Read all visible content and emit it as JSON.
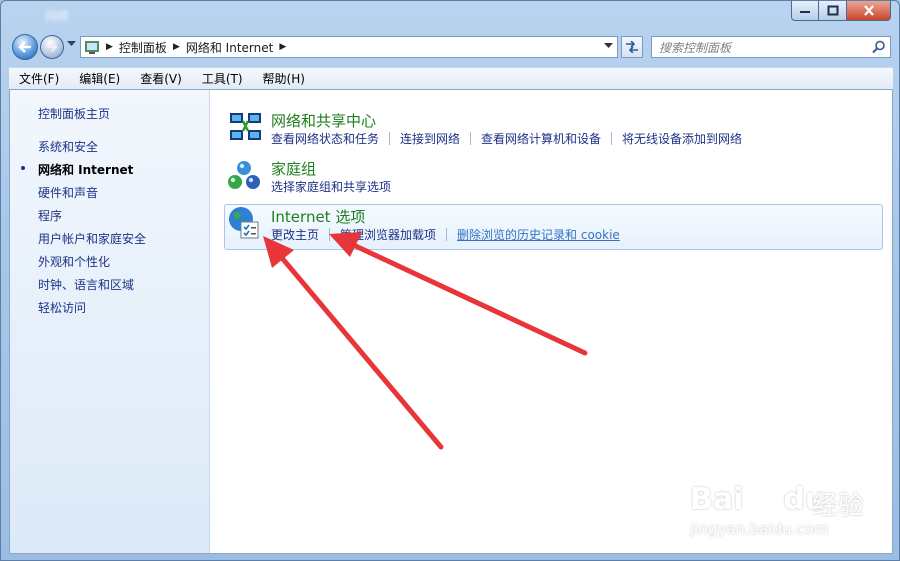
{
  "window": {
    "title_blur": "网络"
  },
  "address": {
    "crumbs": [
      "控制面板",
      "网络和 Internet"
    ],
    "search_placeholder": "搜索控制面板"
  },
  "menu": [
    "文件(F)",
    "编辑(E)",
    "查看(V)",
    "工具(T)",
    "帮助(H)"
  ],
  "sidebar": {
    "home": "控制面板主页",
    "items": [
      {
        "label": "系统和安全"
      },
      {
        "label": "网络和 Internet",
        "current": true
      },
      {
        "label": "硬件和声音"
      },
      {
        "label": "程序"
      },
      {
        "label": "用户帐户和家庭安全"
      },
      {
        "label": "外观和个性化"
      },
      {
        "label": "时钟、语言和区域"
      },
      {
        "label": "轻松访问"
      }
    ]
  },
  "categories": [
    {
      "title": "网络和共享中心",
      "icon": "network-sharing-icon",
      "links": [
        "查看网络状态和任务",
        "连接到网络",
        "查看网络计算机和设备",
        "将无线设备添加到网络"
      ]
    },
    {
      "title": "家庭组",
      "icon": "homegroup-icon",
      "links": [
        "选择家庭组和共享选项"
      ]
    },
    {
      "title": "Internet 选项",
      "icon": "internet-options-icon",
      "links": [
        "更改主页",
        "管理浏览器加载项",
        "删除浏览的历史记录和 cookie"
      ]
    }
  ],
  "watermark": {
    "brand": "Bai",
    "brand2": "du",
    "brand_cn": "经验",
    "url": "jingyan.baidu.com"
  },
  "colors": {
    "link": "#1e3287",
    "category_title": "#1e7f1e",
    "annotation_arrow": "#e8353a"
  }
}
